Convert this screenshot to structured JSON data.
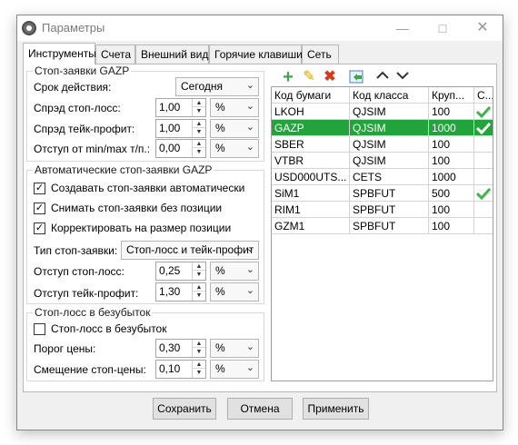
{
  "window": {
    "title": "Параметры"
  },
  "tabs": [
    "Инструменты",
    "Счета",
    "Внешний вид",
    "Горячие клавиши",
    "Сеть"
  ],
  "stop_orders": {
    "group_title": "Стоп-заявки GAZP",
    "validity_label": "Срок действия:",
    "validity_value": "Сегодня",
    "spread_sl_label": "Спрэд стоп-лосс:",
    "spread_sl_value": "1,00",
    "spread_sl_unit": "%",
    "spread_tp_label": "Спрэд тейк-профит:",
    "spread_tp_value": "1,00",
    "spread_tp_unit": "%",
    "offset_label": "Отступ от min/max т/п.:",
    "offset_value": "0,00",
    "offset_unit": "%"
  },
  "auto_stop": {
    "group_title": "Автоматические стоп-заявки GAZP",
    "cb_create": "Создавать стоп-заявки автоматически",
    "cb_create_checked": true,
    "cb_cancel": "Снимать стоп-заявки без позиции",
    "cb_cancel_checked": true,
    "cb_adjust": "Корректировать на размер позиции",
    "cb_adjust_checked": true,
    "type_label": "Тип стоп-заявки:",
    "type_value": "Стоп-лосс и тейк-профит",
    "sl_offset_label": "Отступ стоп-лосс:",
    "sl_offset_value": "0,25",
    "sl_offset_unit": "%",
    "tp_offset_label": "Отступ тейк-профит:",
    "tp_offset_value": "1,30",
    "tp_offset_unit": "%"
  },
  "breakeven": {
    "group_title": "Стоп-лосс в безубыток",
    "cb_label": "Стоп-лосс в безубыток",
    "cb_checked": false,
    "threshold_label": "Порог цены:",
    "threshold_value": "0,30",
    "threshold_unit": "%",
    "shift_label": "Смещение стоп-цены:",
    "shift_value": "0,10",
    "shift_unit": "%"
  },
  "toolbar": {
    "icons": [
      "add-icon",
      "edit-icon",
      "delete-icon",
      "import-icon",
      "move-up-icon",
      "move-down-icon"
    ]
  },
  "grid": {
    "columns": [
      "Код бумаги",
      "Код класса",
      "Круп...",
      "С..."
    ],
    "rows": [
      {
        "code": "LKOH",
        "class": "QJSIM",
        "lot": "100",
        "checked": true,
        "selected": false
      },
      {
        "code": "GAZP",
        "class": "QJSIM",
        "lot": "1000",
        "checked": true,
        "selected": true
      },
      {
        "code": "SBER",
        "class": "QJSIM",
        "lot": "100",
        "checked": false,
        "selected": false
      },
      {
        "code": "VTBR",
        "class": "QJSIM",
        "lot": "100",
        "checked": false,
        "selected": false
      },
      {
        "code": "USD000UTS...",
        "class": "CETS",
        "lot": "1000",
        "checked": false,
        "selected": false
      },
      {
        "code": "SiM1",
        "class": "SPBFUT",
        "lot": "500",
        "checked": true,
        "selected": false
      },
      {
        "code": "RIM1",
        "class": "SPBFUT",
        "lot": "100",
        "checked": false,
        "selected": false
      },
      {
        "code": "GZM1",
        "class": "SPBFUT",
        "lot": "100",
        "checked": false,
        "selected": false
      }
    ]
  },
  "buttons": {
    "save": "Сохранить",
    "cancel": "Отмена",
    "apply": "Применить"
  },
  "colors": {
    "selection": "#23a33b",
    "check": "#3cb54a"
  }
}
